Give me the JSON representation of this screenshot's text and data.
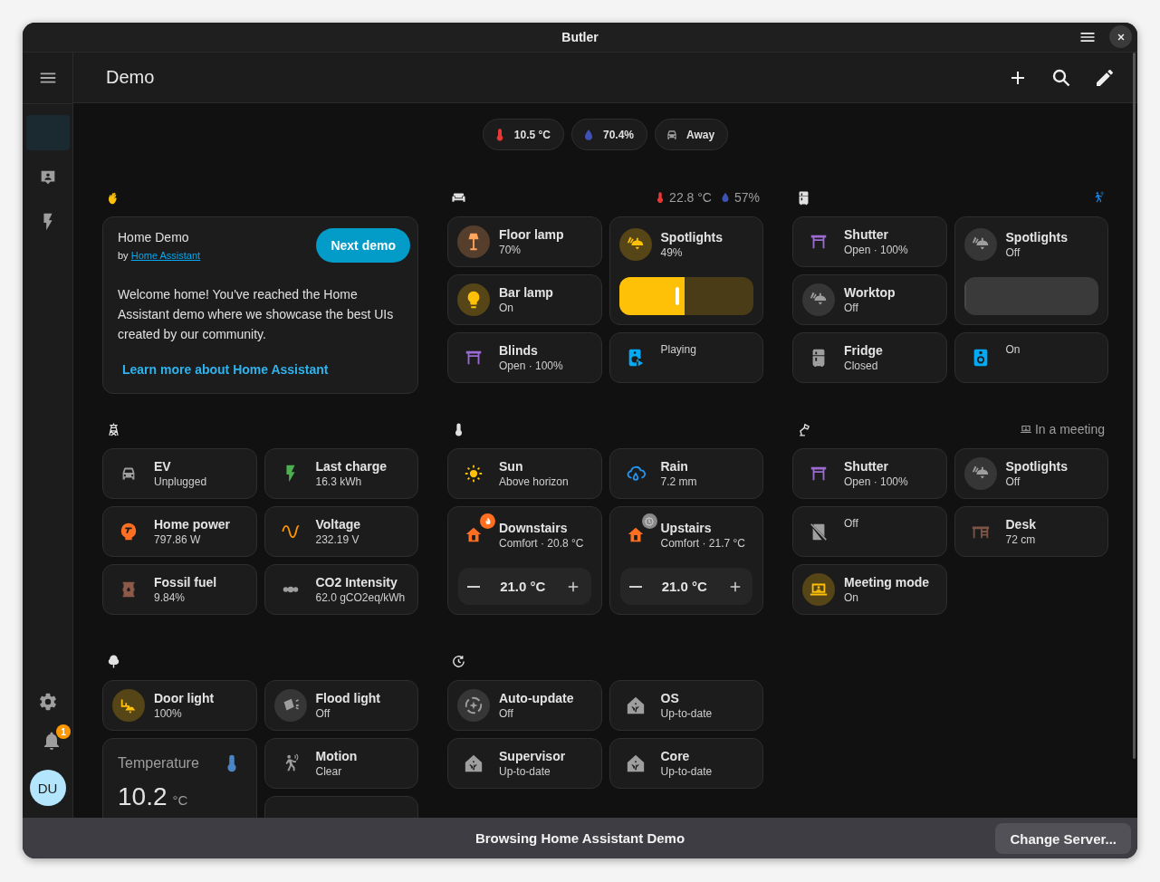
{
  "window": {
    "title": "Butler"
  },
  "sidebar": {
    "items": [
      {
        "selected": true
      },
      {
        "selected": false
      },
      {
        "selected": false
      }
    ],
    "notification_count": "1",
    "avatar": "DU"
  },
  "toolbar": {
    "title": "Demo"
  },
  "badges": [
    {
      "text": "10.5 °C"
    },
    {
      "text": "70.4%"
    },
    {
      "text": "Away"
    }
  ],
  "sections": [
    {
      "cards": [
        {
          "kind": "markdown",
          "title": "Home Demo",
          "byline": "by",
          "author": "Home Assistant",
          "button": "Next demo",
          "text": "Welcome home! You've reached the Home Assistant demo where we showcase the best UIs created by our community.",
          "link": "Learn more about Home Assistant"
        }
      ]
    },
    {
      "header_badges": [
        {
          "text": "22.8 °C"
        },
        {
          "text": "57%"
        }
      ],
      "cards": [
        {
          "kind": "light",
          "name": "Floor lamp",
          "state": "70%",
          "on": true
        },
        {
          "kind": "light-slider",
          "name": "Spotlights",
          "state": "49%",
          "on": true,
          "level": 0.49
        },
        {
          "kind": "light",
          "name": "Bar lamp",
          "state": "On",
          "on": true
        },
        {
          "kind": "entity",
          "name": "Blinds",
          "state": "Open · 100%",
          "on": true
        },
        {
          "kind": "entity",
          "state": "Playing",
          "on": true
        }
      ]
    },
    {
      "header_badges": [
        {
          "active": true
        }
      ],
      "cards": [
        {
          "kind": "entity",
          "name": "Shutter",
          "state": "Open · 100%",
          "on": true
        },
        {
          "kind": "light-slider",
          "name": "Spotlights",
          "state": "Off",
          "on": false,
          "level": 0
        },
        {
          "kind": "light",
          "name": "Worktop",
          "state": "Off",
          "on": false
        },
        {
          "kind": "entity",
          "name": "Fridge",
          "state": "Closed",
          "on": false
        },
        {
          "kind": "entity",
          "state": "On",
          "on": true
        }
      ]
    },
    {
      "cards": [
        {
          "kind": "entity",
          "name": "EV",
          "state": "Unplugged",
          "on": false
        },
        {
          "kind": "entity",
          "name": "Last charge",
          "state": "16.3 kWh",
          "on": true
        },
        {
          "kind": "entity",
          "name": "Home power",
          "state": "797.86 W",
          "on": true
        },
        {
          "kind": "entity",
          "name": "Voltage",
          "state": "232.19 V",
          "on": true
        },
        {
          "kind": "entity",
          "name": "Fossil fuel",
          "state": "9.84%",
          "on": true
        },
        {
          "kind": "entity",
          "name": "CO2 Intensity",
          "state": "62.0 gCO2eq/kWh",
          "on": false
        }
      ]
    },
    {
      "cards": [
        {
          "kind": "entity",
          "name": "Sun",
          "state": "Above horizon",
          "on": true
        },
        {
          "kind": "entity",
          "name": "Rain",
          "state": "7.2 mm",
          "on": true
        },
        {
          "kind": "thermostat",
          "name": "Downstairs",
          "state": "Comfort · 20.8 °C",
          "heating": true,
          "target": "21.0 °C"
        },
        {
          "kind": "thermostat",
          "name": "Upstairs",
          "state": "Comfort · 21.7 °C",
          "heating": false,
          "target": "21.0 °C"
        }
      ]
    },
    {
      "header_badges": [
        {
          "text": "In a meeting"
        }
      ],
      "cards": [
        {
          "kind": "entity",
          "name": "Shutter",
          "state": "Open · 100%",
          "on": true
        },
        {
          "kind": "light",
          "name": "Spotlights",
          "state": "Off",
          "on": false
        },
        {
          "kind": "entity",
          "state": "Off",
          "on": false
        },
        {
          "kind": "entity",
          "name": "Desk",
          "state": "72 cm",
          "on": true
        },
        {
          "kind": "light",
          "name": "Meeting mode",
          "state": "On",
          "on": true
        }
      ]
    },
    {
      "cards": [
        {
          "kind": "light",
          "name": "Door light",
          "state": "100%",
          "on": true
        },
        {
          "kind": "light",
          "name": "Flood light",
          "state": "Off",
          "on": false
        },
        {
          "kind": "sensor",
          "name": "Temperature",
          "value": "10.2",
          "unit": "°C"
        },
        {
          "kind": "entity",
          "name": "Motion",
          "state": "Clear",
          "on": false
        },
        {
          "kind": "blank"
        }
      ]
    },
    {
      "cards": [
        {
          "kind": "light",
          "name": "Auto-update",
          "state": "Off",
          "on": false
        },
        {
          "kind": "entity",
          "name": "OS",
          "state": "Up-to-date",
          "on": false
        },
        {
          "kind": "entity",
          "name": "Supervisor",
          "state": "Up-to-date",
          "on": false
        },
        {
          "kind": "entity",
          "name": "Core",
          "state": "Up-to-date",
          "on": false
        }
      ]
    }
  ],
  "status_bar": {
    "text": "Browsing Home Assistant Demo",
    "button": "Change Server..."
  }
}
